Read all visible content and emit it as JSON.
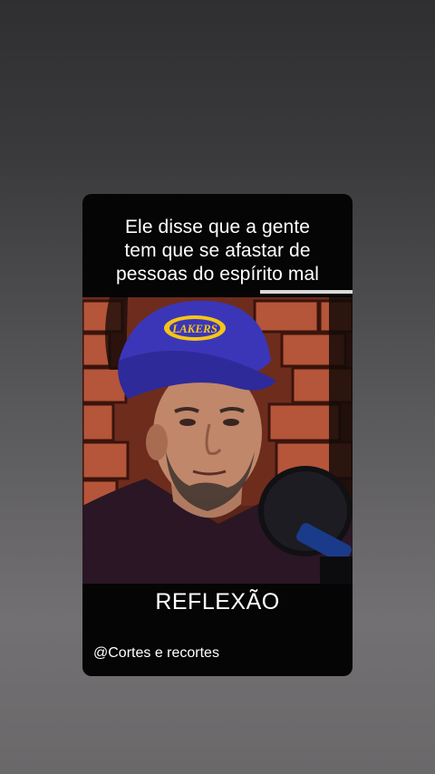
{
  "caption": {
    "lines": [
      "Ele disse que a gente",
      "tem que se afastar de",
      "pessoas do espírito mal"
    ]
  },
  "video": {
    "cap_logo_text": "LAKERS",
    "progress": 0.34
  },
  "title": "REFLEXÃO",
  "handle": "@Cortes e recortes",
  "colors": {
    "card_background": "#050505",
    "cap": "#3b36b8",
    "cap_logo": "#f5c518",
    "text": "#ffffff"
  }
}
